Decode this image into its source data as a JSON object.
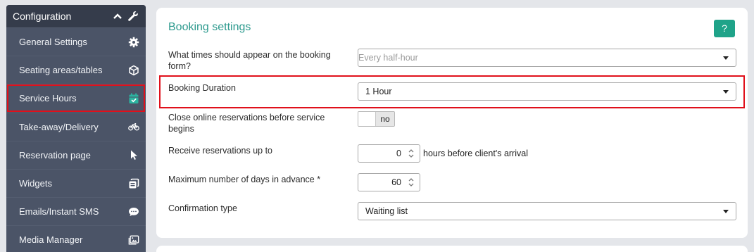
{
  "sidebar": {
    "header": {
      "title": "Configuration",
      "chevron_icon": "chevron-up-icon",
      "wrench_icon": "wrench-icon"
    },
    "items": [
      {
        "label": "General Settings",
        "icon": "gear-icon"
      },
      {
        "label": "Seating areas/tables",
        "icon": "cube-icon"
      },
      {
        "label": "Service Hours",
        "icon": "calendar-check-icon",
        "active": true
      },
      {
        "label": "Take-away/Delivery",
        "icon": "bicycle-icon"
      },
      {
        "label": "Reservation page",
        "icon": "cursor-icon"
      },
      {
        "label": "Widgets",
        "icon": "widgets-icon"
      },
      {
        "label": "Emails/Instant SMS",
        "icon": "chat-bubble-icon"
      },
      {
        "label": "Media Manager",
        "icon": "image-icon"
      }
    ]
  },
  "panel": {
    "title": "Booking settings",
    "help_label": "?",
    "fields": {
      "times": {
        "label": "What times should appear on the booking form?",
        "placeholder": "Every half-hour"
      },
      "duration": {
        "label": "Booking Duration",
        "value": "1 Hour"
      },
      "close_online": {
        "label": "Close online reservations before service begins",
        "value": "no"
      },
      "receive_up_to": {
        "label": "Receive reservations up to",
        "value": "0",
        "suffix": "hours before client's arrival"
      },
      "max_days": {
        "label": "Maximum number of days in advance  *",
        "value": "60"
      },
      "confirmation": {
        "label": "Confirmation type",
        "value": "Waiting list"
      }
    }
  },
  "colors": {
    "accent": "#2d9a8e",
    "help_button": "#1fa389",
    "highlight": "#e0101b",
    "sidebar_bg": "#4b5467",
    "sidebar_header": "#353c4b"
  }
}
